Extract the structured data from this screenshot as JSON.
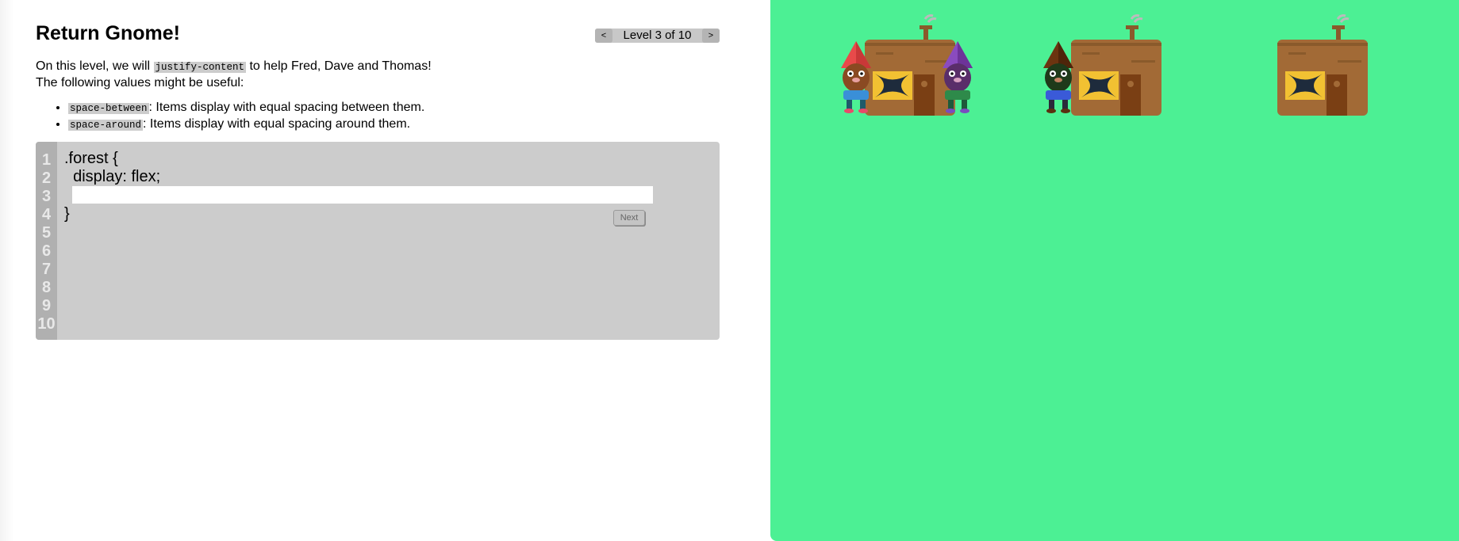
{
  "header": {
    "title": "Return Gnome!",
    "level_text": "Level 3 of 10",
    "prev_label": "<",
    "next_label": ">"
  },
  "intro": {
    "text_before": "On this level, we will ",
    "code_keyword": "justify-content",
    "text_after": " to help Fred, Dave and Thomas!",
    "line2": "The following values might be useful:"
  },
  "hints": [
    {
      "code": "space-between",
      "text": ": Items display with equal spacing between them."
    },
    {
      "code": "space-around",
      "text": ": Items display with equal spacing around them."
    }
  ],
  "editor": {
    "line_numbers": [
      "1",
      "2",
      "3",
      "4",
      "5",
      "6",
      "7",
      "8",
      "9",
      "10"
    ],
    "line1": ".forest {",
    "line2": "  display: flex;",
    "line4": "}",
    "input_value": "",
    "input_placeholder": "",
    "next_button_label": "Next"
  },
  "board": {
    "background_color": "#4cf094",
    "cabins": 3,
    "gnomes": [
      {
        "name": "Fred",
        "hat_color": "#e84a4a"
      },
      {
        "name": "Dave",
        "hat_color": "#8a4bbf"
      },
      {
        "name": "Thomas",
        "hat_color": "#6b3410"
      }
    ]
  }
}
